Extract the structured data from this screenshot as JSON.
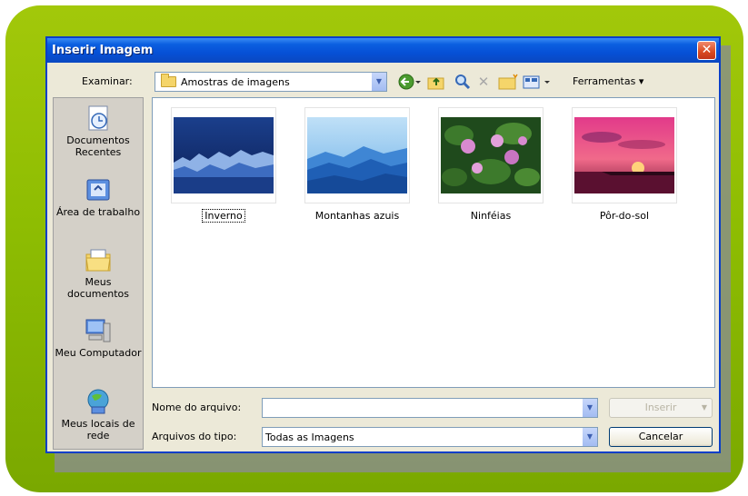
{
  "dialog": {
    "title": "Inserir Imagem",
    "close_label": "✕"
  },
  "toolbar": {
    "lookin_label": "Examinar:",
    "lookin_value": "Amostras de imagens",
    "tools_label": "Ferramentas ▾"
  },
  "places": [
    {
      "label": "Documentos Recentes",
      "icon": "recent-documents-icon"
    },
    {
      "label": "Área de trabalho",
      "icon": "desktop-icon"
    },
    {
      "label": "Meus documentos",
      "icon": "my-documents-icon"
    },
    {
      "label": "Meu Computador",
      "icon": "my-computer-icon"
    },
    {
      "label": "Meus locais de rede",
      "icon": "network-places-icon"
    }
  ],
  "files": [
    {
      "name": "Inverno",
      "selected": true
    },
    {
      "name": "Montanhas azuis",
      "selected": false
    },
    {
      "name": "Ninféias",
      "selected": false
    },
    {
      "name": "Pôr-do-sol",
      "selected": false
    }
  ],
  "bottom": {
    "filename_label": "Nome do arquivo:",
    "filename_value": "",
    "filetype_label": "Arquivos do tipo:",
    "filetype_value": "Todas as Imagens",
    "insert_label": "Inserir",
    "cancel_label": "Cancelar"
  },
  "colors": {
    "frame_green": "#8ebd02",
    "titlebar_blue": "#0650d6",
    "close_red": "#d8491f"
  }
}
